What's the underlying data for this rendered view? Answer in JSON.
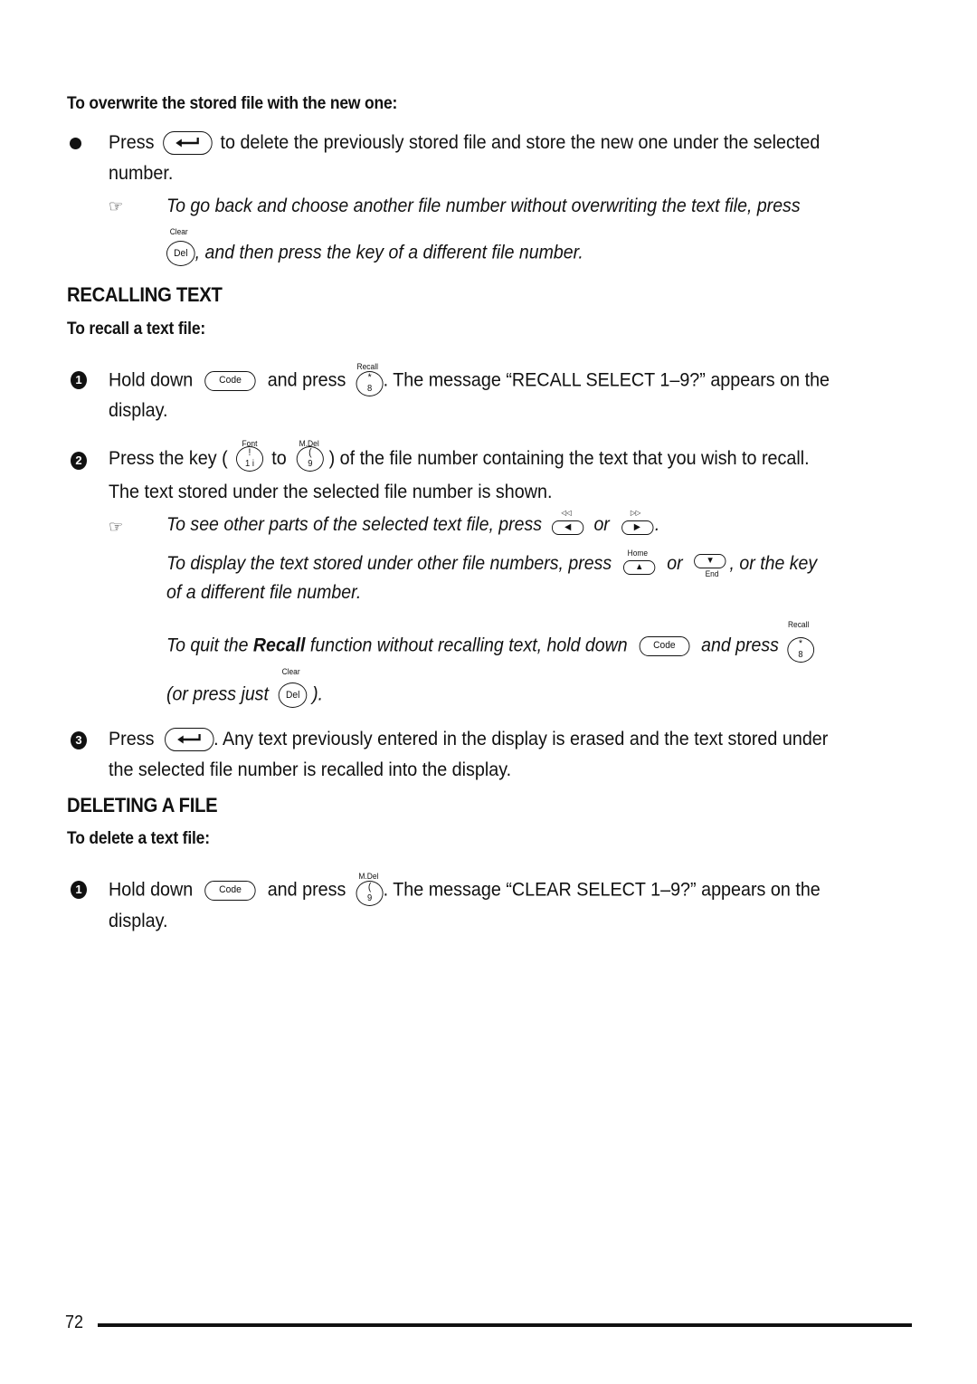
{
  "overwrite_section": {
    "heading": "To overwrite the stored file with the new one:",
    "bullet": {
      "pre": "Press",
      "key": "enter-key",
      "post_line1": "to delete the previously stored file and store the new one under the selected",
      "post_line2": "number."
    },
    "note": {
      "line1": "To go back and choose another file number without overwriting the text file, press",
      "key_caption": "Clear",
      "key_label": "Del",
      "line2": ", and then press the key of a different file number."
    }
  },
  "recalling_section": {
    "heading": "RECALLING TEXT",
    "subheading": "To recall a text file:",
    "step1": {
      "number": "1",
      "pre": "Hold down",
      "key1": "Code",
      "mid": "and press",
      "key2_caption": "Recall",
      "key2_top": "*",
      "key2_bottom": "8",
      "post": ". The message “RECALL SELECT 1–9?” appears on the",
      "line2": "display."
    },
    "step2": {
      "number": "2",
      "pre": "Press the key (",
      "key1_caption": "Font",
      "key1_top": "!",
      "key1_bottom": "1 i",
      "mid": "to",
      "key2_caption": "M.Del",
      "key2_top": "(",
      "key2_bottom": "9",
      "post": ") of the file number containing the text that you wish to recall.",
      "line2": "The text stored under the selected file number is shown."
    },
    "step2_notes": {
      "note1_pre": "To see other parts of the selected text file, press",
      "note1_key1_caption": "◁◁",
      "note1_mid": "or",
      "note1_key2_caption": "▷▷",
      "note1_post": ".",
      "note2_pre": "To display the text stored under other file numbers, press",
      "note2_key1_caption": "Home",
      "note2_mid": "or",
      "note2_key2_caption": "End",
      "note2_post": ", or the key",
      "note2_line2": "of a different file number.",
      "note3_pre": "To quit the",
      "note3_bold": "Recall",
      "note3_mid": "function without recalling text, hold down",
      "note3_key1": "Code",
      "note3_mid2": "and press",
      "note3_key2_caption": "Recall",
      "note3_key2_top": "*",
      "note3_key2_bottom": "8",
      "note4_pre": "(or press just",
      "note4_key_caption": "Clear",
      "note4_key_label": "Del",
      "note4_post": ")."
    },
    "step3": {
      "number": "3",
      "pre": "Press",
      "post": ". Any text previously entered in the display is erased and the text stored under",
      "line2": "the selected file number is recalled into the display."
    }
  },
  "deleting_section": {
    "heading": "DELETING A FILE",
    "subheading": "To delete a text file:",
    "step1": {
      "number": "1",
      "pre": "Hold down",
      "key1": "Code",
      "mid": "and press",
      "key2_caption": "M.Del",
      "key2_top": "(",
      "key2_bottom": "9",
      "post": ". The message “CLEAR SELECT 1–9?” appears on the",
      "line2": "display."
    }
  },
  "footer": {
    "page_number": "72"
  },
  "icons": {
    "bullet": "●",
    "hand": "☞",
    "enter_arrow": "↵",
    "left_arrow": "◀",
    "right_arrow": "▶",
    "up_arrow": "▲",
    "down_arrow": "▼"
  }
}
